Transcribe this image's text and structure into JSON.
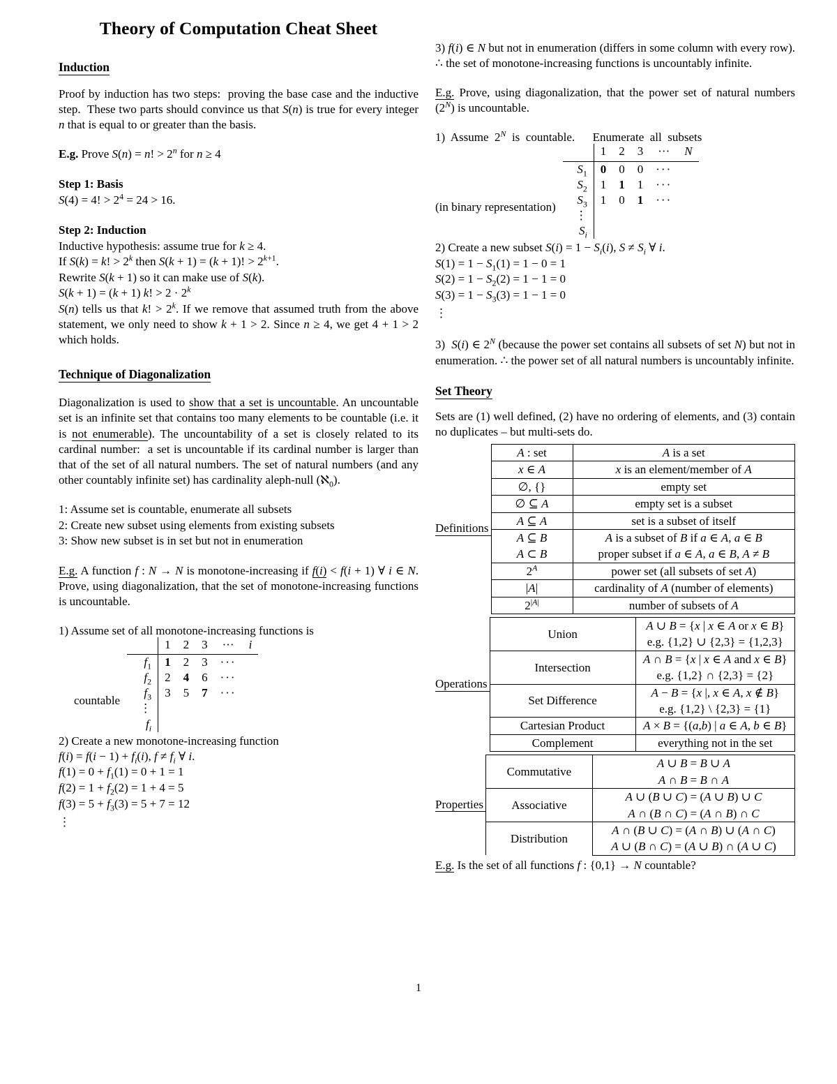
{
  "document": {
    "title": "Theory of Computation Cheat Sheet",
    "page_number": "1"
  },
  "left_column": {
    "induction": {
      "heading": "Induction",
      "intro": "Proof by induction has two steps: proving the base case and the inductive step. These two parts should convince us that S(n) is true for every integer n that is equal to or greater than the basis.",
      "eg_label": "E.g.",
      "eg_text": "Prove S(n) = n! > 2ⁿ for n ≥ 4",
      "step1_heading": "Step 1: Basis",
      "step1_line": "S(4) = 4! > 2⁴ = 24 > 16.",
      "step2_heading": "Step 2: Induction",
      "step2_lines": [
        "Inductive hypothesis: assume true for k ≥ 4.",
        "If S(k) = k! > 2ᵏ then S(k + 1) = (k + 1)! > 2ᵏ⁺¹.",
        "Rewrite S(k + 1) so it can make use of S(k).",
        "S(k + 1) = (k + 1) k! > 2 · 2ᵏ"
      ],
      "step2_para": "S(n) tells us that k! > 2ᵏ. If we remove that assumed truth from the above statement, we only need to show k + 1 > 2. Since n ≥ 4, we get 4 + 1 > 2 which holds."
    },
    "diagonalization": {
      "heading": "Technique of Diagonalization",
      "intro": "Diagonalization is used to show that a set is uncountable. An uncountable set is an infinite set that contains too many elements to be countable (i.e. it is not enumerable). The uncountability of a set is closely related to its cardinal number: a set is uncountable if its cardinal number is larger than that of the set of all natural numbers. The set of natural numbers (and any other countably infinite set) has cardinality aleph-null (ℵ0).",
      "underline_phrase_1": "show that a set is uncountable",
      "underline_phrase_2": "not enumerable",
      "steps": [
        "1: Assume set is countable, enumerate all subsets",
        "2: Create new subset using elements from existing subsets",
        "3: Show new subset is in set but not in enumeration"
      ],
      "example_label": "E.g.",
      "example_text": "A function f : N → N is monotone-increasing if f(i) < f(i + 1) ∀ i ∈ N. Prove, using diagonalization, that the set of monotone-increasing functions is uncountable.",
      "step1_text": "1) Assume set of all monotone-increasing functions is",
      "table_side_label": "countable",
      "step2_text": "2) Create a new monotone-increasing function",
      "step2_lines": [
        "f(i) = f(i − 1) + fᵢ(i), f ≠ fᵢ ∀ i.",
        "f(1) = 0 + f₁(1) = 0 + 1 = 1",
        "f(2) = 1 + f₂(2) = 1 + 4 = 5",
        "f(3) = 5 + f₃(3) = 5 + 7 = 12"
      ]
    }
  },
  "right_column": {
    "step3_monotone": "3) f(i) ∈ N but not in enumeration (differs in some column with every row). ∴ the set of monotone-increasing functions is uncountably infinite.",
    "powerset_example_label": "E.g.",
    "powerset_example_text": "Prove, using diagonalization, that the power set of natural numbers (2ᴺ) is uncountable.",
    "powerset_step1": "1) Assume 2ᴺ is countable.    Enumerate all subsets",
    "powerset_table_side_label": "(in binary representation)",
    "powerset_step2_head": "2) Create a new subset S(i) = 1 − Sᵢ(i), S ≠ Sᵢ ∀ i.",
    "powerset_step2_lines": [
      "S(1) = 1 − S₁(1) = 1 − 0 = 1",
      "S(2) = 1 − S₂(2) = 1 − 1 = 0",
      "S(3) = 1 − S₃(3) = 1 − 1 = 0"
    ],
    "powerset_step3": "3) S(i) ∈ 2ᴺ (because the power set contains all subsets of set N) but not in enumeration. ∴ the power set of all natural numbers is uncountably infinite.",
    "set_theory": {
      "heading": "Set Theory",
      "intro": "Sets are (1) well defined, (2) have no ordering of elements, and (3) contain no duplicates – but multi-sets do.",
      "definitions_label": "Definitions",
      "operations_label": "Operations",
      "properties_label": "Properties",
      "final_eg_label": "E.g.",
      "final_eg_text": "Is the set of all functions f : {0,1} → N countable?"
    }
  },
  "chart_data": {
    "type": "table",
    "monotone_table": {
      "title": "Enumeration of monotone-increasing functions",
      "column_headers": [
        "1",
        "2",
        "3",
        "···",
        "i"
      ],
      "row_headers": [
        "f₁",
        "f₂",
        "f₃",
        "⋮",
        "fᵢ"
      ],
      "rows": [
        [
          "1",
          "2",
          "3",
          "···",
          ""
        ],
        [
          "2",
          "4",
          "6",
          "···",
          ""
        ],
        [
          "3",
          "5",
          "7",
          "···",
          ""
        ],
        [
          "",
          "",
          "",
          "",
          ""
        ],
        [
          "",
          "",
          "",
          "",
          ""
        ]
      ],
      "bold_diagonal": [
        [
          0,
          0
        ],
        [
          1,
          1
        ],
        [
          2,
          2
        ]
      ],
      "side_label": "countable"
    },
    "powerset_table": {
      "title": "Enumeration of subsets of N in binary",
      "column_headers": [
        "1",
        "2",
        "3",
        "···",
        "N"
      ],
      "row_headers": [
        "S₁",
        "S₂",
        "S₃",
        "⋮",
        "Sᵢ"
      ],
      "rows": [
        [
          "0",
          "0",
          "0",
          "···",
          ""
        ],
        [
          "1",
          "1",
          "1",
          "···",
          ""
        ],
        [
          "1",
          "0",
          "1",
          "···",
          ""
        ],
        [
          "",
          "",
          "",
          "",
          ""
        ],
        [
          "",
          "",
          "",
          "",
          ""
        ]
      ],
      "bold_diagonal": [
        [
          0,
          0
        ],
        [
          1,
          1
        ],
        [
          2,
          2
        ]
      ],
      "side_label": "(in binary representation)"
    },
    "definitions_rows": [
      {
        "key": "A : set",
        "value": "A is a set"
      },
      {
        "key": "x ∈ A",
        "value": "x is an element/member of A"
      },
      {
        "key": "∅, {}",
        "value": "empty set"
      },
      {
        "key": "∅ ⊆ A",
        "value": "empty set is a subset"
      },
      {
        "key": "A ⊆ A",
        "value": "set is a subset of itself"
      },
      {
        "key": "A ⊆ B",
        "value": "A is a subset of B if a ∈ A, a ∈ B"
      },
      {
        "key": "A ⊂ B",
        "value": "proper subset if a ∈ A, a ∈ B, A ≠ B"
      },
      {
        "key": "2ᴬ",
        "value": "power set (all subsets of set A)"
      },
      {
        "key": "|A|",
        "value": "cardinality of A (number of elements)"
      },
      {
        "key": "2^|A|",
        "value": "number of subsets of A"
      }
    ],
    "operations_rows": [
      {
        "key": "Union",
        "value": "A ∪ B = {x | x ∈ A or x ∈ B}",
        "example": "e.g. {1,2} ∪ {2,3} = {1,2,3}"
      },
      {
        "key": "Intersection",
        "value": "A ∩ B = {x | x ∈ A and x ∈ B}",
        "example": "e.g. {1,2} ∩ {2,3} = {2}"
      },
      {
        "key": "Set Difference",
        "value": "A − B = {x |, x ∈ A, x ∉ B}",
        "example": "e.g. {1,2} \\ {2,3} = {1}"
      },
      {
        "key": "Cartesian Product",
        "value": "A × B = {(a,b) | a ∈ A, b ∈ B}",
        "example": ""
      },
      {
        "key": "Complement",
        "value": "everything not in the set",
        "example": ""
      }
    ],
    "properties_rows": [
      {
        "key": "Commutative",
        "value1": "A ∪ B = B ∪ A",
        "value2": "A ∩ B = B ∩ A"
      },
      {
        "key": "Associative",
        "value1": "A ∪ (B ∪ C) = (A ∪ B) ∪ C",
        "value2": "A ∩ (B ∩ C) = (A ∩ B) ∩ C"
      },
      {
        "key": "Distribution",
        "value1": "A ∩ (B ∪ C) = (A ∩ B) ∪ (A ∩ C)",
        "value2": "A ∪ (B ∩ C) = (A ∪ B) ∩ (A ∪ C)"
      }
    ]
  }
}
